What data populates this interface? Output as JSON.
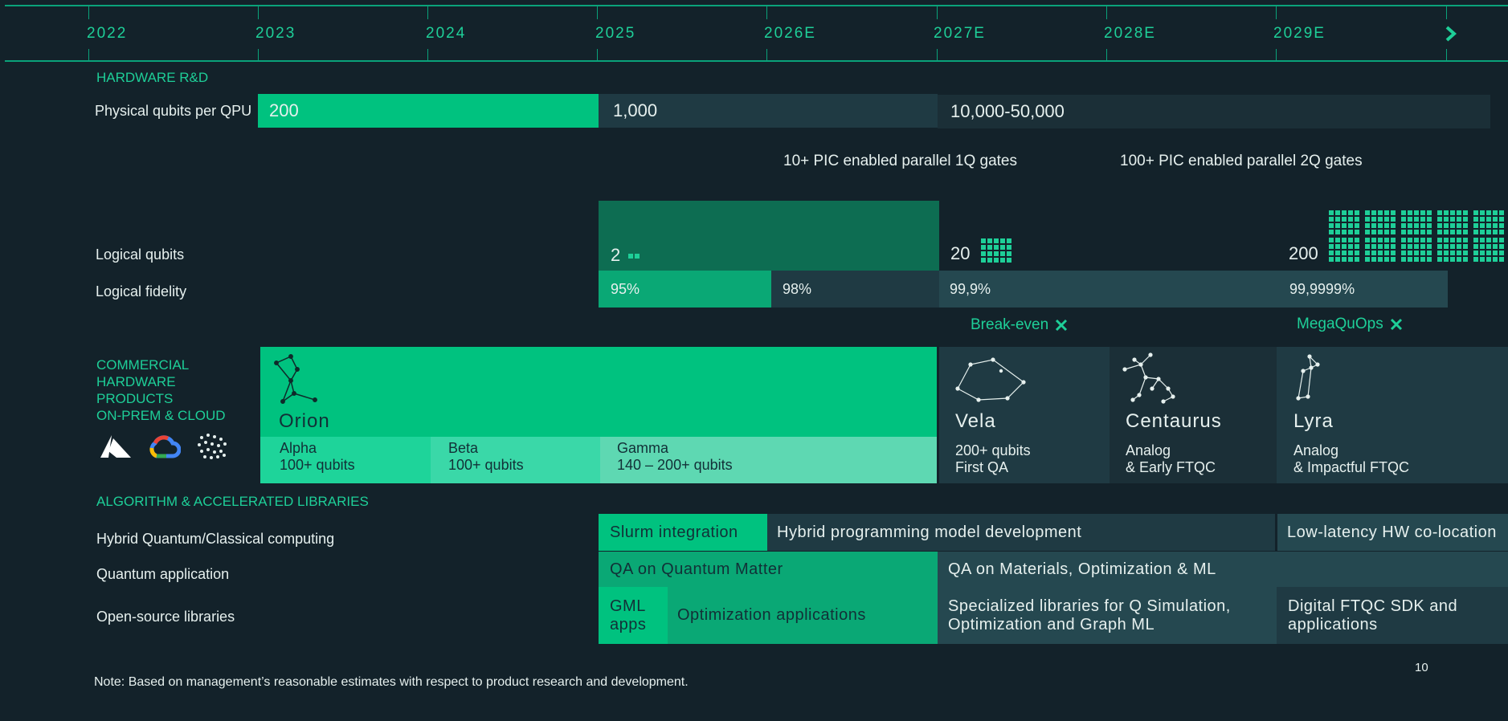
{
  "timeline": {
    "years": [
      "2022",
      "2023",
      "2024",
      "2025",
      "2026E",
      "2027E",
      "2028E",
      "2029E"
    ],
    "next_icon": "chevron-right-icon"
  },
  "hardware": {
    "section_title": "HARDWARE R&D",
    "physical_label": "Physical qubits per QPU",
    "physical_values": [
      "200",
      "1,000",
      "10,000-50,000"
    ],
    "gates": [
      "10+ PIC enabled parallel 1Q gates",
      "100+ PIC enabled parallel 2Q gates"
    ],
    "logical_label": "Logical qubits",
    "logical_values": [
      "2",
      "20",
      "200"
    ],
    "fidelity_label": "Logical fidelity",
    "fidelity_values": [
      "95%",
      "98%",
      "99,9%",
      "99,9999%"
    ],
    "milestones": [
      "Break-even",
      "MegaQuOps"
    ]
  },
  "commercial": {
    "section_title_lines": [
      "COMMERCIAL",
      "HARDWARE",
      "PRODUCTS",
      "ON-PREM & CLOUD"
    ],
    "cloud_logos": [
      "azure-logo",
      "google-cloud-logo",
      "dotted-cloud-logo"
    ],
    "orion": {
      "name": "Orion",
      "subs": [
        {
          "name": "Alpha",
          "qubits": "100+ qubits"
        },
        {
          "name": "Beta",
          "qubits": "100+ qubits"
        },
        {
          "name": "Gamma",
          "qubits": "140 – 200+ qubits"
        }
      ]
    },
    "products": [
      {
        "name": "Vela",
        "line1": "200+ qubits",
        "line2": "First QA"
      },
      {
        "name": "Centaurus",
        "line1": "Analog",
        "line2": "& Early FTQC"
      },
      {
        "name": "Lyra",
        "line1": "Analog",
        "line2": "& Impactful FTQC"
      }
    ]
  },
  "algorithms": {
    "section_title": "ALGORITHM & ACCELERATED LIBRARIES",
    "hybrid_label": "Hybrid Quantum/Classical computing",
    "hybrid_items": [
      "Slurm integration",
      "Hybrid programming model development",
      "Low-latency HW co-location"
    ],
    "qapp_label": "Quantum application",
    "qapp_items": [
      "QA on Quantum Matter",
      "QA on Materials, Optimization & ML"
    ],
    "oss_label": "Open-source libraries",
    "oss_items": {
      "gml": [
        "GML",
        "apps"
      ],
      "optim": "Optimization applications",
      "spec": [
        "Specialized libraries for Q Simulation,",
        "Optimization and Graph ML"
      ],
      "digital": [
        "Digital FTQC SDK and",
        "applications"
      ]
    }
  },
  "footer": {
    "note": "Note: Based on management’s reasonable estimates with respect to product research and development.",
    "page_number": "10"
  },
  "colors": {
    "background": "#13222a",
    "accent": "#1ecf98",
    "bright_green": "#00c27f",
    "dark_teal": "#1f3a43"
  }
}
